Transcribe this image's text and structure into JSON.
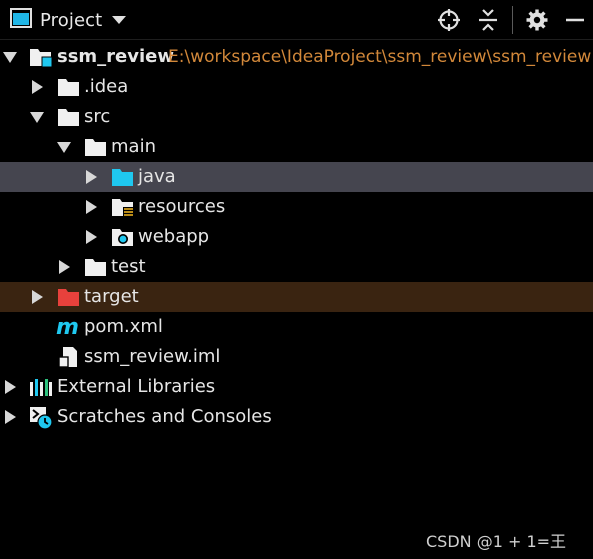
{
  "header": {
    "title": "Project",
    "icons": [
      "project-view-icon",
      "locate-icon",
      "collapse-all-icon",
      "settings-gear-icon",
      "minimize-icon"
    ]
  },
  "tree": {
    "root": {
      "name": "ssm_review",
      "path": "E:\\workspace\\IdeaProject\\ssm_review\\ssm_review"
    },
    "idea": "idea",
    "idea_prefix": ".",
    "src": "src",
    "main": "main",
    "java": "java",
    "resources": "resources",
    "webapp": "webapp",
    "test": "test",
    "target": "target",
    "pom": "pom.xml",
    "iml": "ssm_review.iml",
    "ext_libs": "External Libraries",
    "scratches": "Scratches and Consoles"
  },
  "colors": {
    "background": "#000000",
    "selected_row": "#45454f",
    "excluded_row": "#3a2411",
    "excluded_folder": "#e8413c",
    "source_folder": "#1fc8f0",
    "path_text": "#d2883a"
  },
  "watermark": "CSDN @1 + 1=王"
}
